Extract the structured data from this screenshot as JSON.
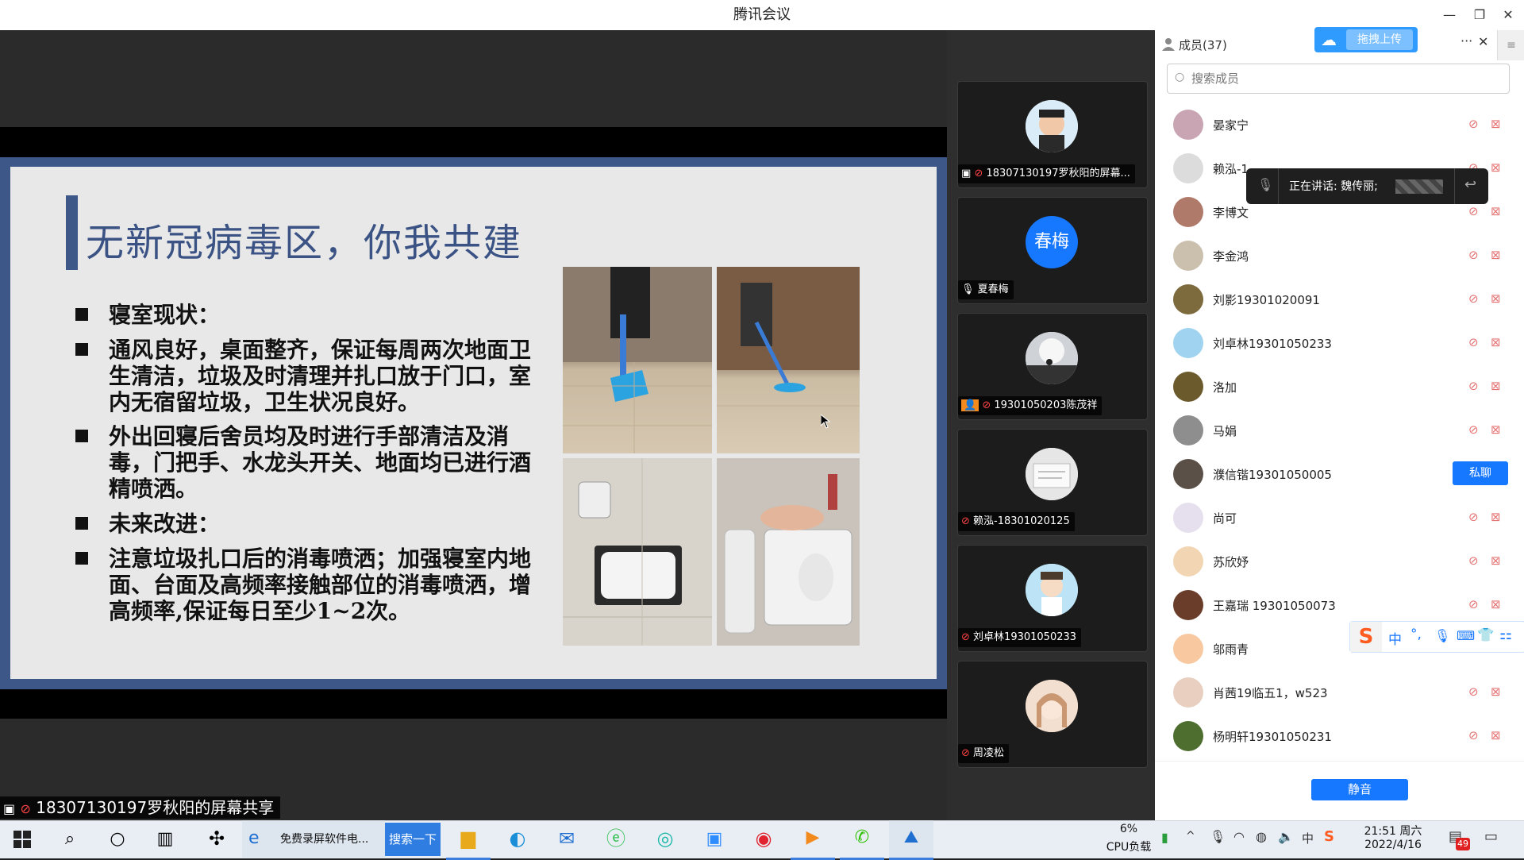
{
  "window": {
    "title": "腾讯会议",
    "minimize": "—",
    "restore": "❐",
    "close": "✕"
  },
  "slide": {
    "title": "无新冠病毒区，你我共建",
    "bullets": [
      "寝室现状：",
      "通风良好，桌面整齐，保证每周两次地面卫生清洁，垃圾及时清理并扎口放于门口，室内无宿留垃圾，卫生状况良好。",
      "外出回寝后舍员均及时进行手部清洁及消毒，门把手、水龙头开关、地面均已进行酒精喷洒。",
      "未来改进：",
      "注意垃圾扎口后的消毒喷洒；加强寝室内地面、台面及高频率接触部位的消毒喷洒，增高频率,保证每日至少1~2次。"
    ]
  },
  "share_label": "18307130197罗秋阳的屏幕共享",
  "tiles": [
    {
      "label": "18307130197罗秋阳的屏幕...",
      "avatar_text": ""
    },
    {
      "label": "夏春梅",
      "avatar_text": "春梅"
    },
    {
      "label": "19301050203陈茂祥",
      "avatar_text": ""
    },
    {
      "label": "赖泓-18301020125",
      "avatar_text": ""
    },
    {
      "label": "刘卓林19301050233",
      "avatar_text": ""
    },
    {
      "label": "周凌松",
      "avatar_text": ""
    }
  ],
  "panel": {
    "members_title": "成员(37)",
    "upload_button": "拖拽上传",
    "more": "···",
    "close": "✕",
    "search_placeholder": "搜索成员",
    "speaking_prefix": "正在讲话: 魏传丽;",
    "chat_button": "私聊",
    "mute_all_button": "静音",
    "members": [
      "晏家宁",
      "赖泓-1",
      "李博文",
      "李金鸿",
      "刘影19301020091",
      "刘卓林19301050233",
      "洛加",
      "马娟",
      "濮信锴19301050005",
      "尚可",
      "苏欣妤",
      "王嘉瑞 19301050073",
      "邬雨青",
      "肖茜19临五1，w523",
      "杨明轩19301050231"
    ],
    "ime": {
      "lang": "中",
      "punct": "°,"
    }
  },
  "taskbar": {
    "browser_tab": "免费录屏软件电...",
    "search_button": "搜索一下",
    "cpu_percent": "6%",
    "cpu_label": "CPU负载",
    "time": "21:51 周六",
    "date": "2022/4/16",
    "ime_lang": "中",
    "notif_count": "49"
  },
  "colors": {
    "accent": "#1677ff",
    "slide_blue": "#3d5888",
    "upload_blue": "#2f9bff"
  }
}
